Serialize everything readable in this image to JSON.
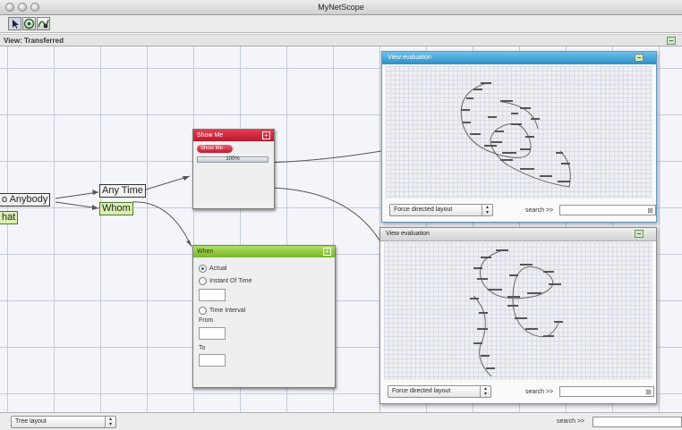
{
  "window": {
    "title": "MyNetScope"
  },
  "toolbar": {
    "tools": [
      "select-tool-icon",
      "network-tool-icon",
      "chart-tool-icon"
    ]
  },
  "view": {
    "title": "View: Transferred"
  },
  "graph": {
    "nodes": {
      "anybody": "o Anybody",
      "what": "hat",
      "any_time": "Any Time",
      "whom": "Whom"
    }
  },
  "show_me": {
    "title": "Show Me",
    "button": "Show Me",
    "progress_text": "100%",
    "progress": 1.0
  },
  "when": {
    "title": "When",
    "options": [
      "Actual",
      "Instant Of Time",
      "Time Interval"
    ],
    "selected": "Actual",
    "from_label": "From",
    "to_label": "To"
  },
  "eval_top": {
    "title": "View evaluation",
    "layout": "Force directed layout",
    "search_label": "search >>",
    "search_value": "",
    "clear_icon": "close-icon"
  },
  "eval_bottom": {
    "title": "View evaluation",
    "layout": "Force directed layout",
    "search_label": "search >>",
    "search_value": "",
    "clear_icon": "close-icon"
  },
  "bottom": {
    "layout": "Tree layout",
    "search_label": "search >>",
    "search_value": ""
  },
  "colors": {
    "show_me_header": "#d0213a",
    "when_header": "#8ec63f",
    "eval_top_header": "#3aa3d4",
    "eval_bottom_header": "#dcdcdc"
  }
}
